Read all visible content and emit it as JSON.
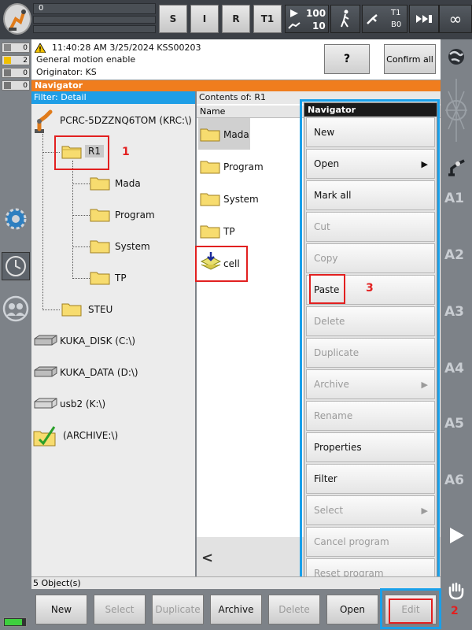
{
  "top": {
    "progress_value": "0",
    "buttons": [
      "S",
      "I",
      "R",
      "T1"
    ],
    "override_top": "100",
    "override_bottom": "10",
    "tool_top": "T1",
    "tool_bottom": "B0",
    "infinity": "∞"
  },
  "counters": [
    "0",
    "2",
    "0",
    "0"
  ],
  "message": {
    "line1": "11:40:28 AM 3/25/2024 KSS00203",
    "line2": "General motion enable",
    "line3": "Originator: KS",
    "help_label": "?",
    "confirm_label": "Confirm all"
  },
  "navigator": {
    "title": "Navigator",
    "filter": "Filter: Detail",
    "contents_of": "Contents of: R1",
    "name_col": "Name"
  },
  "tree": {
    "root": "PCRC-5DZZNQ6TOM (KRC:\\)",
    "r1": "R1",
    "children": [
      "Mada",
      "Program",
      "System",
      "TP"
    ],
    "steu": "STEU",
    "drives": [
      "KUKA_DISK (C:\\)",
      "KUKA_DATA (D:\\)",
      "usb2 (K:\\)",
      "(ARCHIVE:\\)"
    ]
  },
  "contents": [
    "Mada",
    "Program",
    "System",
    "TP",
    "cell"
  ],
  "scroll_left": "<",
  "context_menu": {
    "title": "Navigator",
    "items": [
      {
        "label": "New"
      },
      {
        "label": "Open",
        "arrow": "▶"
      },
      {
        "label": "Mark all"
      },
      {
        "label": "Cut"
      },
      {
        "label": "Copy"
      },
      {
        "label": "Paste"
      },
      {
        "label": "Delete"
      },
      {
        "label": "Duplicate"
      },
      {
        "label": "Archive",
        "arrow": "▶"
      },
      {
        "label": "Rename"
      },
      {
        "label": "Properties"
      },
      {
        "label": "Filter"
      },
      {
        "label": "Select",
        "arrow": "▶"
      },
      {
        "label": "Cancel program"
      },
      {
        "label": "Reset program"
      }
    ]
  },
  "axes": [
    "A1",
    "A2",
    "A3",
    "A4",
    "A5",
    "A6"
  ],
  "status": {
    "object_count": "5 Object(s)"
  },
  "bottom_buttons": [
    "New",
    "Select",
    "Duplicate",
    "Archive",
    "Delete",
    "Open",
    "Edit"
  ],
  "annotations": [
    "1",
    "2",
    "3"
  ]
}
